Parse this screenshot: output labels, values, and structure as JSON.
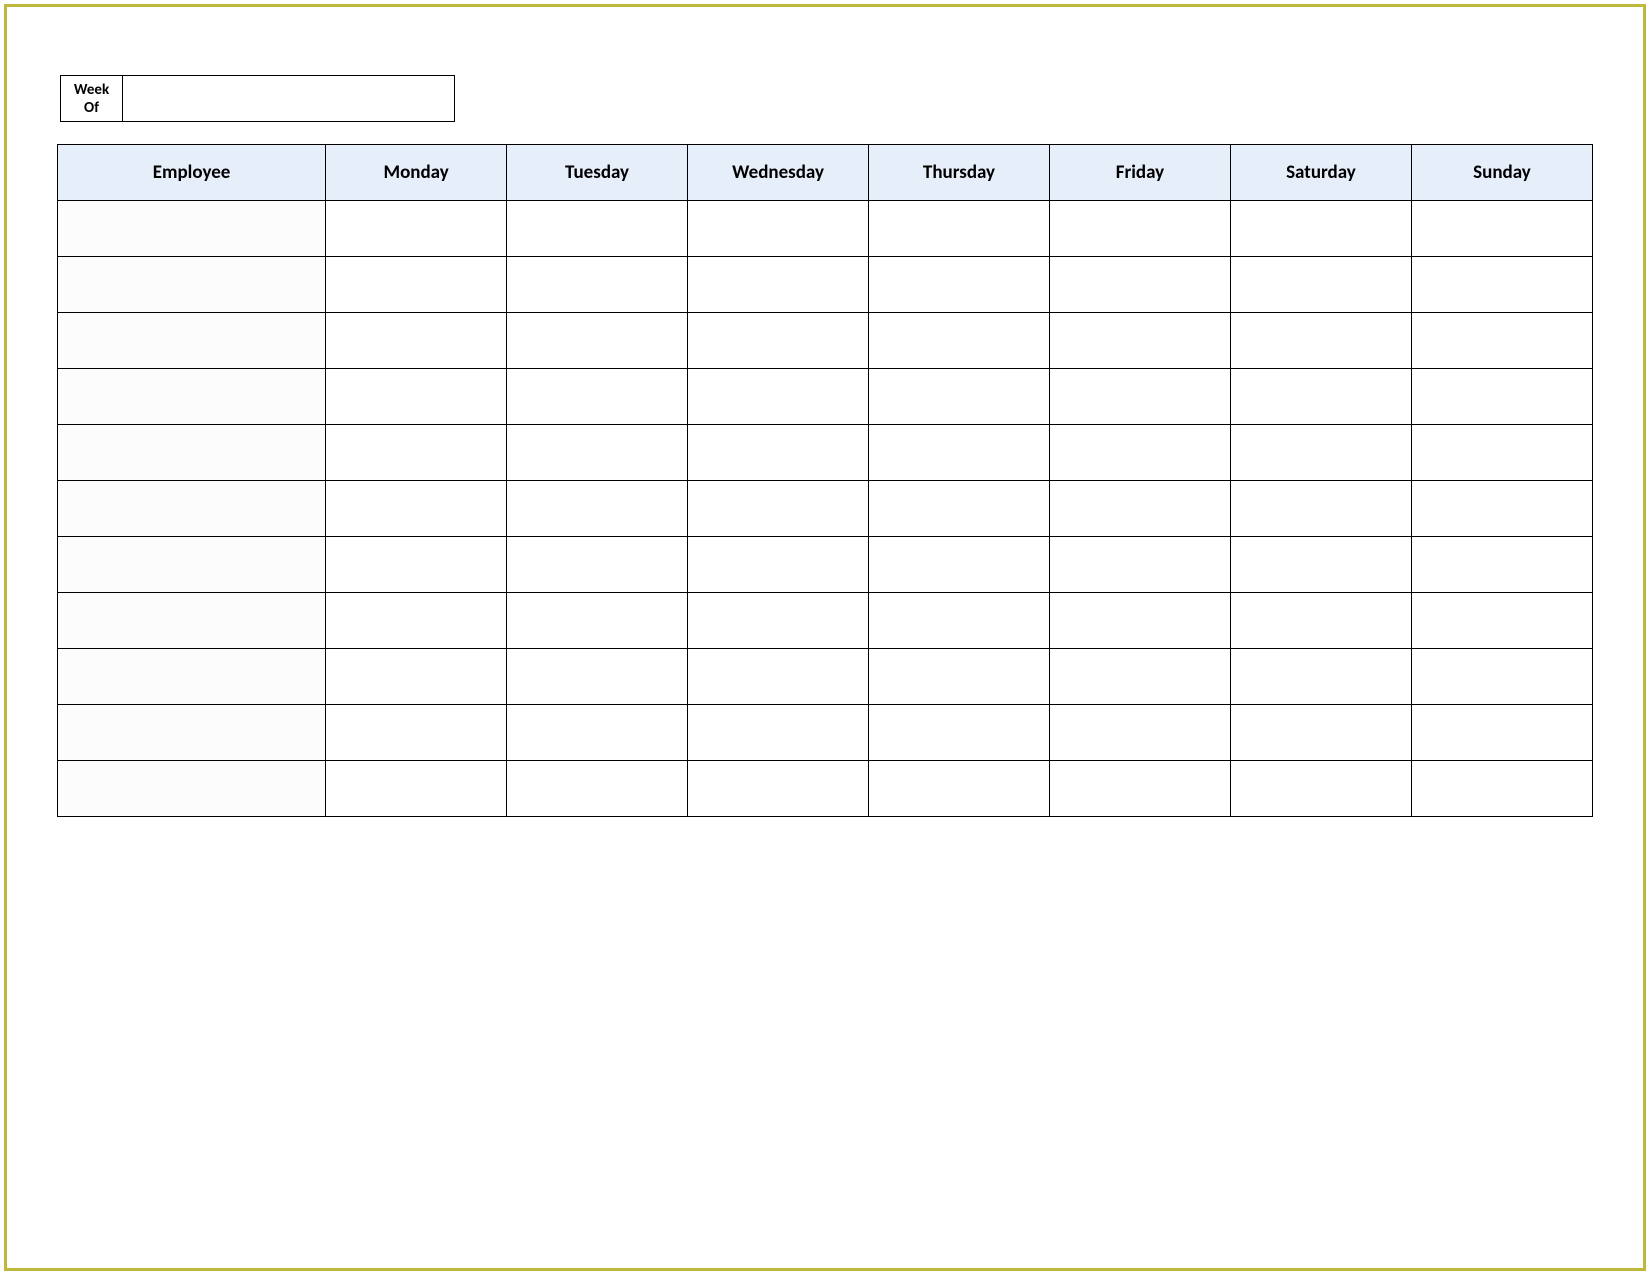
{
  "weekOf": {
    "label": "Week Of",
    "value": ""
  },
  "table": {
    "headers": [
      "Employee",
      "Monday",
      "Tuesday",
      "Wednesday",
      "Thursday",
      "Friday",
      "Saturday",
      "Sunday"
    ],
    "rows": [
      {
        "employee": "",
        "monday": "",
        "tuesday": "",
        "wednesday": "",
        "thursday": "",
        "friday": "",
        "saturday": "",
        "sunday": ""
      },
      {
        "employee": "",
        "monday": "",
        "tuesday": "",
        "wednesday": "",
        "thursday": "",
        "friday": "",
        "saturday": "",
        "sunday": ""
      },
      {
        "employee": "",
        "monday": "",
        "tuesday": "",
        "wednesday": "",
        "thursday": "",
        "friday": "",
        "saturday": "",
        "sunday": ""
      },
      {
        "employee": "",
        "monday": "",
        "tuesday": "",
        "wednesday": "",
        "thursday": "",
        "friday": "",
        "saturday": "",
        "sunday": ""
      },
      {
        "employee": "",
        "monday": "",
        "tuesday": "",
        "wednesday": "",
        "thursday": "",
        "friday": "",
        "saturday": "",
        "sunday": ""
      },
      {
        "employee": "",
        "monday": "",
        "tuesday": "",
        "wednesday": "",
        "thursday": "",
        "friday": "",
        "saturday": "",
        "sunday": ""
      },
      {
        "employee": "",
        "monday": "",
        "tuesday": "",
        "wednesday": "",
        "thursday": "",
        "friday": "",
        "saturday": "",
        "sunday": ""
      },
      {
        "employee": "",
        "monday": "",
        "tuesday": "",
        "wednesday": "",
        "thursday": "",
        "friday": "",
        "saturday": "",
        "sunday": ""
      },
      {
        "employee": "",
        "monday": "",
        "tuesday": "",
        "wednesday": "",
        "thursday": "",
        "friday": "",
        "saturday": "",
        "sunday": ""
      },
      {
        "employee": "",
        "monday": "",
        "tuesday": "",
        "wednesday": "",
        "thursday": "",
        "friday": "",
        "saturday": "",
        "sunday": ""
      },
      {
        "employee": "",
        "monday": "",
        "tuesday": "",
        "wednesday": "",
        "thursday": "",
        "friday": "",
        "saturday": "",
        "sunday": ""
      }
    ]
  }
}
